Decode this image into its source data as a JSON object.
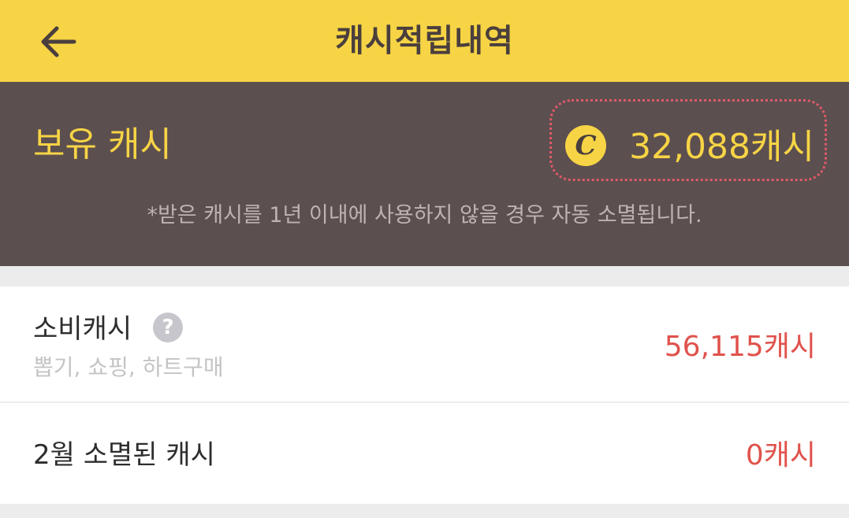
{
  "header": {
    "title": "캐시적립내역",
    "back_icon": "arrow-left-icon"
  },
  "balance": {
    "label": "보유 캐시",
    "coin_icon": "cash-coin-icon",
    "coin_letter": "C",
    "amount": "32,088캐시",
    "notice": "*받은 캐시를 1년 이내에 사용하지 않을 경우 자동 소멸됩니다."
  },
  "spent": {
    "label": "소비캐시",
    "help_icon": "question-circle-icon",
    "help_glyph": "?",
    "sub": "뽑기, 쇼핑, 하트구매",
    "value": "56,115캐시"
  },
  "expired": {
    "label": "2월 소멸된 캐시",
    "value": "0캐시"
  },
  "colors": {
    "header_bg": "#f7d445",
    "panel_bg": "#5c4f4f",
    "accent_yellow": "#f7d445",
    "value_red": "#e0524c",
    "highlight_border": "#e05a68"
  }
}
